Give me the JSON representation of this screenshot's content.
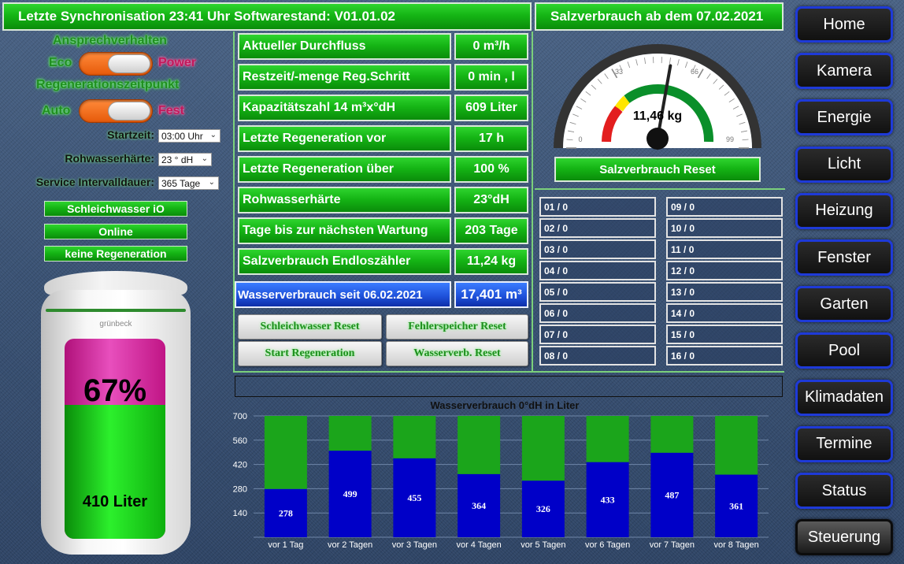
{
  "header": {
    "sync_text": "Letzte Synchronisation 23:41 Uhr Softwarestand: V01.01.02",
    "salt_title": "Salzverbrauch ab dem 07.02.2021"
  },
  "settings": {
    "response_title": "Ansprechverhalten",
    "response_left": "Eco",
    "response_right": "Power",
    "regen_title": "Regenerationszeitpunkt",
    "regen_left": "Auto",
    "regen_right": "Fest",
    "start_label": "Startzeit:",
    "start_value": "03:00 Uhr",
    "hardness_label": "Rohwasserhärte:",
    "hardness_value": "23 ° dH",
    "service_label": "Service Intervalldauer:",
    "service_value": "365 Tage"
  },
  "status": {
    "leak": "Schleichwasser iO",
    "online": "Online",
    "regen": "keine Regeneration"
  },
  "device": {
    "brand": "grünbeck",
    "percent": "67%",
    "liters": "410 Liter",
    "fill_fraction": 0.67
  },
  "rows": [
    {
      "label": "Aktueller Durchfluss",
      "value": "0 m³/h"
    },
    {
      "label": "Restzeit/-menge Reg.Schritt",
      "value": "0 min , l"
    },
    {
      "label": "Kapazitätszahl 14 m³x°dH",
      "value": "609 Liter"
    },
    {
      "label": "Letzte Regeneration vor",
      "value": "17 h"
    },
    {
      "label": "Letzte Regeneration über",
      "value": "100 %"
    },
    {
      "label": "Rohwasserhärte",
      "value": "23°dH"
    },
    {
      "label": "Tage bis zur nächsten Wartung",
      "value": "203 Tage"
    },
    {
      "label": "Salzverbrauch Endloszähler",
      "value": "11,24 kg"
    }
  ],
  "water_usage": {
    "label": "Wasserverbrauch seit 06.02.2021",
    "value": "17,401 m³"
  },
  "buttons": {
    "leak_reset": "Schleichwasser Reset",
    "error_reset": "Fehlerspeicher Reset",
    "start_regen": "Start Regeneration",
    "water_reset": "Wasserverb. Reset",
    "salt_reset": "Salzverbrauch Reset"
  },
  "gauge": {
    "value_text": "11,46 kg",
    "ticks": [
      "0",
      "33",
      "66",
      "99"
    ],
    "min": 0,
    "max": 99,
    "value": 55
  },
  "slots": [
    "01 / 0",
    "02 / 0",
    "03 / 0",
    "04 / 0",
    "05 / 0",
    "06 / 0",
    "07 / 0",
    "08 / 0",
    "09 / 0",
    "10 / 0",
    "11 / 0",
    "12 / 0",
    "13 / 0",
    "14 / 0",
    "15 / 0",
    "16 / 0"
  ],
  "nav": [
    "Home",
    "Kamera",
    "Energie",
    "Licht",
    "Heizung",
    "Fenster",
    "Garten",
    "Pool",
    "Klimadaten",
    "Termine",
    "Status",
    "Steuerung"
  ],
  "colors": {
    "green": "#1bbf1b",
    "blue": "#0000c8",
    "nav_border": "#1e3ad8"
  },
  "chart_data": {
    "type": "bar",
    "title": "Wasserverbrauch 0°dH in Liter",
    "categories": [
      "vor 1 Tag",
      "vor 2 Tagen",
      "vor 3 Tagen",
      "vor 4 Tagen",
      "vor 5 Tagen",
      "vor 6 Tagen",
      "vor 7 Tagen",
      "vor 8 Tagen"
    ],
    "values": [
      278,
      499,
      455,
      364,
      326,
      433,
      487,
      361
    ],
    "ylim": [
      0,
      700
    ],
    "yticks": [
      140,
      280,
      420,
      560,
      700
    ],
    "grid": true,
    "legend": "none"
  }
}
